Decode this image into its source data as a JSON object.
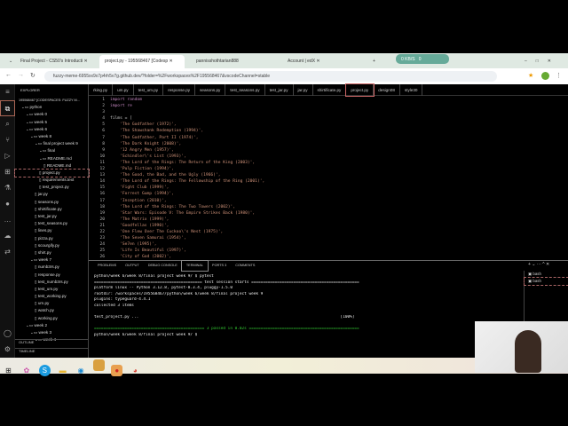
{
  "browser": {
    "tabs": [
      {
        "title": "Final Project - CS50's Introducti"
      },
      {
        "title": "project.py - 195568467 [Codesp"
      },
      {
        "title": "pannisshothtarian888"
      },
      {
        "title": "Account | edX"
      }
    ],
    "url": "fuzzy-meme-6955xx9x7p4rh5v7g.github.dev/?folder=%2Fworkspaces%2F195568467&vscodeChannel=stable",
    "net_badge": "0 KB/S",
    "net_count": "0"
  },
  "explorer": {
    "title": "EXPLORER",
    "root": "195568467 [CODESPACES: FUZZY M...",
    "items": [
      {
        "label": "python",
        "d": 1,
        "t": "f"
      },
      {
        "label": "week 0",
        "d": 2,
        "t": "f"
      },
      {
        "label": "week 5",
        "d": 2,
        "t": "f"
      },
      {
        "label": "week 6",
        "d": 2,
        "t": "f"
      },
      {
        "label": "week 8",
        "d": 3,
        "t": "f"
      },
      {
        "label": "final project week 9",
        "d": 4,
        "t": "f"
      },
      {
        "label": "final",
        "d": 5,
        "t": "f"
      },
      {
        "label": "README.md",
        "d": 5,
        "t": "f"
      },
      {
        "label": "README.md",
        "d": 6,
        "t": "x"
      },
      {
        "label": "project.py",
        "d": 5,
        "t": "x",
        "sel": true
      },
      {
        "label": "requirements.text",
        "d": 5,
        "t": "x"
      },
      {
        "label": "test_project.py",
        "d": 5,
        "t": "x"
      },
      {
        "label": "jar.py",
        "d": 4,
        "t": "x"
      },
      {
        "label": "seasons.py",
        "d": 4,
        "t": "x"
      },
      {
        "label": "shirtificate.py",
        "d": 4,
        "t": "x"
      },
      {
        "label": "test_jar.py",
        "d": 4,
        "t": "x"
      },
      {
        "label": "test_seasons.py",
        "d": 4,
        "t": "x"
      },
      {
        "label": "lines.py",
        "d": 4,
        "t": "x"
      },
      {
        "label": "pizza.py",
        "d": 4,
        "t": "x"
      },
      {
        "label": "scourgify.py",
        "d": 4,
        "t": "x"
      },
      {
        "label": "shirt.py",
        "d": 4,
        "t": "x"
      },
      {
        "label": "week 7",
        "d": 3,
        "t": "f"
      },
      {
        "label": "numb3rs.py",
        "d": 4,
        "t": "x"
      },
      {
        "label": "response.py",
        "d": 4,
        "t": "x"
      },
      {
        "label": "test_numb3rs.py",
        "d": 4,
        "t": "x"
      },
      {
        "label": "test_um.py",
        "d": 4,
        "t": "x"
      },
      {
        "label": "test_working.py",
        "d": 4,
        "t": "x"
      },
      {
        "label": "um.py",
        "d": 4,
        "t": "x"
      },
      {
        "label": "watch.py",
        "d": 4,
        "t": "x"
      },
      {
        "label": "working.py",
        "d": 4,
        "t": "x"
      },
      {
        "label": "week 2",
        "d": 2,
        "t": "f"
      },
      {
        "label": "week 3",
        "d": 3,
        "t": "f"
      },
      {
        "label": "week 4",
        "d": 4,
        "t": "f"
      }
    ],
    "outline": "OUTLINE",
    "timeline": "TIMELINE"
  },
  "editor_tabs": [
    "rking.py",
    "um.py",
    "test_um.py",
    "response.py",
    "seasons.py",
    "test_seasons.py",
    "test_jar.py",
    "jar.py",
    "shirtificate.py",
    "project.py",
    "design08",
    "style30"
  ],
  "code": [
    "import random",
    "import re",
    "",
    "films = [",
    "    'The Godfather (1972)',",
    "    'The Shawshank Redemption (1994)',",
    "    'The Godfather, Part II (1974)',",
    "    'The Dark Knight (2008)',",
    "    '12 Angry Men (1957)',",
    "    'Schindler\\'s List (1993)',",
    "    'The Lord of the Rings: The Return of the King (2003)',",
    "    'Pulp Fiction (1994)',",
    "    'The Good, the Bad, and the Ugly (1966)',",
    "    'The Lord of the Rings: The Fellowship of the Ring (2001)',",
    "    'Fight Club (1999)',",
    "    'Forrest Gump (1994)',",
    "    'Inception (2010)',",
    "    'The Lord of the Rings: The Two Towers (2002)',",
    "    'Star Wars: Episode V: The Empire Strikes Back (1980)',",
    "    'The Matrix (1999)',",
    "    'Goodfellas (1990)',",
    "    'One Flew Over The Cuckoo\\'s Nest (1975)',",
    "    'The Seven Samurai (1954)',",
    "    'Se7en (1995)',",
    "    'Life Is Beautiful (1997)',",
    "    'City of God (2002)',"
  ],
  "panel": {
    "tabs": [
      "PROBLEMS",
      "OUTPUT",
      "DEBUG CONSOLE",
      "TERMINAL",
      "PORTS 3",
      "COMMENTS"
    ],
    "terminal": [
      "python/week 6/week 8/final project week 9/ $ pytest",
      "============================================== test session starts ==============================================",
      "platform linux -- Python 3.12.8, pytest-8.3.4, pluggy-1.5.0",
      "rootdir: /workspaces/195568467/python/week 6/week 8/final project week 9",
      "plugins: typeguard-4.4.1",
      "collected 3 items",
      "",
      "test_project.py ...                                                                                      [100%]",
      "",
      "=============================================== 3 passed in 0.02s ===============================================",
      "python/week 6/week 8/final project week 9/ $"
    ],
    "terminals": [
      "bash",
      "bash"
    ]
  }
}
